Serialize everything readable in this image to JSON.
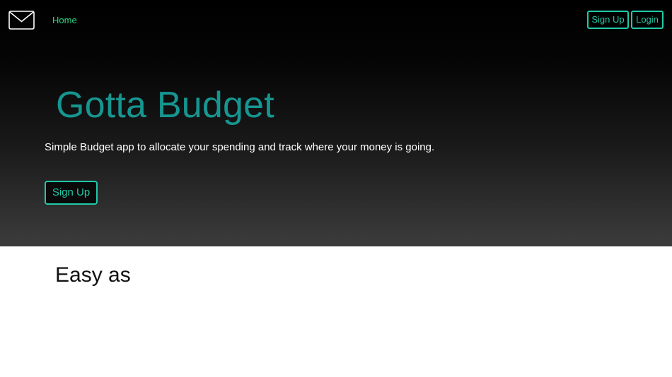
{
  "navbar": {
    "logo_icon": "envelope-icon",
    "home_label": "Home",
    "signup_label": "Sign Up",
    "login_label": "Login"
  },
  "hero": {
    "title": "Gotta Budget",
    "subtitle": "Simple Budget app to allocate your spending and track where your money is going.",
    "signup_label": "Sign Up"
  },
  "section": {
    "heading": "Easy as"
  },
  "colors": {
    "accent": "#20c9a8",
    "title": "#169690",
    "home_link": "#2ed484",
    "hero_top": "#000000",
    "hero_bottom": "#3c3c3c"
  }
}
